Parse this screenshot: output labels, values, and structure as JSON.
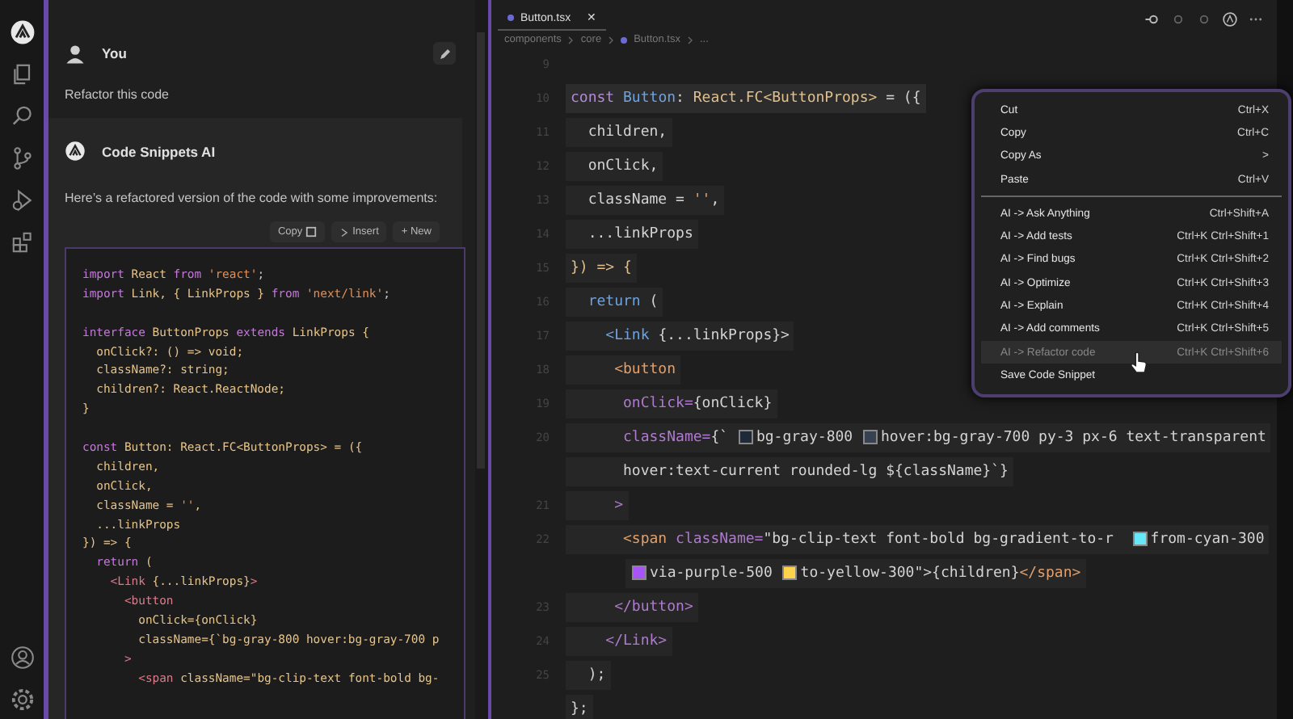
{
  "chat": {
    "user": {
      "name": "You",
      "message": "Refactor this code"
    },
    "assistant": {
      "name": "Code Snippets AI",
      "intro": "Here’s a refactored version of the code with some improvements:",
      "actions": [
        {
          "label": "Copy",
          "kind": "copy"
        },
        {
          "label": "Insert",
          "kind": "insert"
        },
        {
          "label": "+ New",
          "kind": "plain"
        }
      ],
      "code": [
        [
          {
            "kind": "kw",
            "text": "import "
          },
          {
            "kind": "id",
            "text": "React "
          },
          {
            "kind": "kw",
            "text": "from "
          },
          {
            "kind": "str",
            "text": "'react'"
          },
          {
            "kind": "plain",
            "text": ";"
          }
        ],
        [
          {
            "kind": "kw",
            "text": "import "
          },
          {
            "kind": "id",
            "text": "Link, { LinkProps } "
          },
          {
            "kind": "kw",
            "text": "from "
          },
          {
            "kind": "str",
            "text": "'next/link'"
          },
          {
            "kind": "plain",
            "text": ";"
          }
        ],
        [
          {
            "kind": "gap"
          },
          {
            "kind": "kw",
            "text": "interface "
          },
          {
            "kind": "id",
            "text": "ButtonProps "
          },
          {
            "kind": "kw",
            "text": "extends "
          },
          {
            "kind": "id",
            "text": "LinkProps {"
          }
        ],
        [
          {
            "kind": "id",
            "text": "  onClick?: () => void;"
          }
        ],
        [
          {
            "kind": "id",
            "text": "  className?: string;"
          }
        ],
        [
          {
            "kind": "id",
            "text": "  children?: React.ReactNode;"
          }
        ],
        [
          {
            "kind": "id",
            "text": "}"
          }
        ],
        [
          {
            "kind": "gap"
          },
          {
            "kind": "kw",
            "text": "const "
          },
          {
            "kind": "id",
            "text": "Button: React.FC<ButtonProps> = ({"
          }
        ],
        [
          {
            "kind": "id",
            "text": "  children,"
          }
        ],
        [
          {
            "kind": "id",
            "text": "  onClick,"
          }
        ],
        [
          {
            "kind": "id",
            "text": "  className = "
          },
          {
            "kind": "str",
            "text": "''"
          },
          {
            "kind": "id",
            "text": ","
          }
        ],
        [
          {
            "kind": "id",
            "text": "  ...linkProps"
          }
        ],
        [
          {
            "kind": "id",
            "text": "}) => {"
          }
        ],
        [
          {
            "kind": "kw",
            "text": "  return "
          },
          {
            "kind": "id",
            "text": "("
          }
        ],
        [
          {
            "kind": "tag",
            "text": "    <Link "
          },
          {
            "kind": "id",
            "text": "{...linkProps}"
          },
          {
            "kind": "tag",
            "text": ">"
          }
        ],
        [
          {
            "kind": "tag",
            "text": "      <button"
          }
        ],
        [
          {
            "kind": "id",
            "text": "        onClick={onClick}"
          }
        ],
        [
          {
            "kind": "id",
            "text": "        className={`bg-gray-800 hover:bg-gray-700 p"
          }
        ],
        [
          {
            "kind": "tag",
            "text": "      >"
          }
        ],
        [
          {
            "kind": "tag",
            "text": "        <span "
          },
          {
            "kind": "id",
            "text": "className=\"bg-clip-text font-bold bg-"
          }
        ]
      ]
    }
  },
  "editor": {
    "tab": {
      "label": "Button.tsx",
      "close": "✕",
      "selected": true
    },
    "breadcrumb": [
      "components",
      "core",
      "Button.tsx",
      "..."
    ],
    "lines": [
      {
        "num": "9"
      },
      {
        "num": "10",
        "segments": [
          {
            "kind": "kw",
            "text": "const "
          },
          {
            "kind": "fn",
            "text": "Button"
          },
          {
            "kind": "plain",
            "text": ": "
          },
          {
            "kind": "id",
            "text": "React.FC<ButtonProps>"
          },
          {
            "kind": "plain",
            "text": " = ({"
          }
        ]
      },
      {
        "num": "11",
        "segments": [
          {
            "kind": "plain",
            "text": "  children,"
          }
        ]
      },
      {
        "num": "12",
        "segments": [
          {
            "kind": "plain",
            "text": "  onClick,"
          }
        ]
      },
      {
        "num": "13",
        "segments": [
          {
            "kind": "plain",
            "text": "  className = "
          },
          {
            "kind": "str",
            "text": "''"
          },
          {
            "kind": "plain",
            "text": ","
          }
        ]
      },
      {
        "num": "14",
        "segments": [
          {
            "kind": "plain",
            "text": "  ...linkProps"
          }
        ]
      },
      {
        "num": "15",
        "segments": [
          {
            "kind": "id",
            "text": "}) => {"
          }
        ]
      },
      {
        "num": "16",
        "segments": [
          {
            "kind": "fn",
            "text": "  return "
          },
          {
            "kind": "plain",
            "text": "("
          }
        ]
      },
      {
        "num": "17",
        "segments": [
          {
            "kind": "tag",
            "text": "    <Link "
          },
          {
            "kind": "plain",
            "text": "{...linkProps}>"
          }
        ]
      },
      {
        "num": "18",
        "segments": [
          {
            "kind": "str",
            "text": "     <button"
          }
        ]
      },
      {
        "num": "19",
        "segments": [
          {
            "kind": "attr",
            "text": "      onClick="
          },
          {
            "kind": "plain",
            "text": "{onClick}"
          }
        ]
      },
      {
        "num": "20",
        "segments": [
          {
            "kind": "attr",
            "text": "      className="
          },
          {
            "kind": "plain",
            "text": "{` "
          },
          {
            "kind": "swatch",
            "color": "#1f2937"
          },
          {
            "kind": "plain",
            "text": "bg-gray-800 "
          },
          {
            "kind": "swatch",
            "color": "#374151"
          },
          {
            "kind": "plain",
            "text": "hover:bg-gray-700 py-3 px-6 text-transparent"
          }
        ]
      },
      {
        "segments": [
          {
            "kind": "plain",
            "text": "      hover:text-current rounded-lg ${className}`}"
          }
        ]
      },
      {
        "num": "21",
        "segments": [
          {
            "kind": "attr",
            "text": "     >"
          }
        ]
      },
      {
        "num": "22",
        "segments": [
          {
            "kind": "str",
            "text": "      <span "
          },
          {
            "kind": "attr",
            "text": "className="
          },
          {
            "kind": "plain",
            "text": "\"bg-clip-text font-bold bg-gradient-to-r  "
          },
          {
            "kind": "swatch",
            "color": "#67e8f9"
          },
          {
            "kind": "plain",
            "text": "from-cyan-300"
          }
        ]
      },
      {
        "segments": [
          {
            "kind": "swatch",
            "color": "#a855f7"
          },
          {
            "kind": "plain",
            "text": "via-purple-500 "
          },
          {
            "kind": "swatch",
            "color": "#fcd34d"
          },
          {
            "kind": "plain",
            "text": "to-yellow-300\">{children}"
          },
          {
            "kind": "str",
            "text": "</span>"
          }
        ]
      },
      {
        "num": "23",
        "segments": [
          {
            "kind": "attr",
            "text": "     </button>"
          }
        ]
      },
      {
        "num": "24",
        "segments": [
          {
            "kind": "attr",
            "text": "    </Link>"
          }
        ]
      },
      {
        "num": "25",
        "segments": [
          {
            "kind": "plain",
            "text": "  );"
          }
        ]
      },
      {
        "segments": [
          {
            "kind": "plain",
            "text": "};"
          }
        ]
      }
    ]
  },
  "context_menu": {
    "groups": [
      [
        {
          "label": "Cut",
          "shortcut": "Ctrl+X",
          "selected": false
        },
        {
          "label": "Copy",
          "shortcut": "Ctrl+C",
          "selected": false
        },
        {
          "label": "Copy As",
          "shortcut": ">",
          "selected": false
        },
        {
          "label": "Paste",
          "shortcut": "Ctrl+V",
          "selected": false
        }
      ],
      [
        {
          "label": "AI -> Ask Anything",
          "shortcut": "Ctrl+Shift+A",
          "selected": false
        },
        {
          "label": "AI -> Add tests",
          "shortcut": "Ctrl+K Ctrl+Shift+1",
          "selected": false
        },
        {
          "label": "AI -> Find bugs",
          "shortcut": "Ctrl+K Ctrl+Shift+2",
          "selected": false
        },
        {
          "label": "AI -> Optimize",
          "shortcut": "Ctrl+K Ctrl+Shift+3",
          "selected": false
        },
        {
          "label": "AI -> Explain",
          "shortcut": "Ctrl+K Ctrl+Shift+4",
          "selected": false
        },
        {
          "label": "AI -> Add comments",
          "shortcut": "Ctrl+K Ctrl+Shift+5",
          "selected": false
        },
        {
          "label": "AI -> Refactor code",
          "shortcut": "Ctrl+K Ctrl+Shift+6",
          "selected": true
        },
        {
          "label": "Save Code Snippet",
          "selected": false
        }
      ]
    ]
  }
}
